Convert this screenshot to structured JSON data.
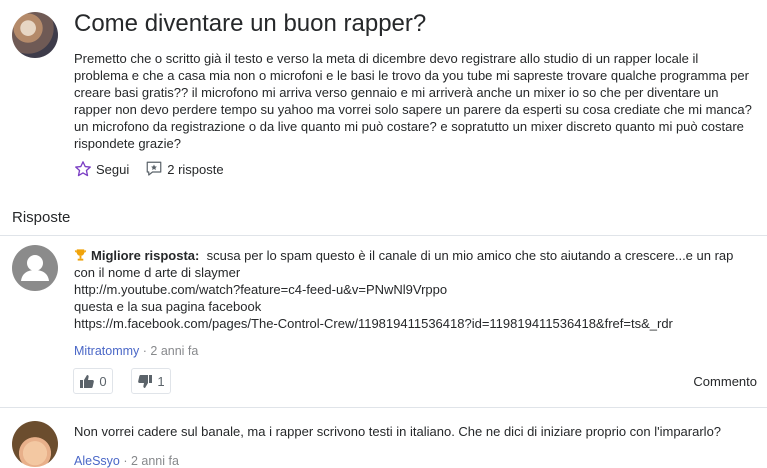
{
  "question": {
    "title": "Come diventare un buon rapper?",
    "body_lines": [
      "Premetto che o scritto già il testo e verso la meta di dicembre devo registrare allo studio di un rapper locale il",
      "problema e che a casa mia non o microfoni e le basi le trovo da you tube mi sapreste trovare qualche programma per",
      "creare basi gratis?? il microfono mi arriva verso gennaio e mi arriverà anche un mixer io so che per diventare un",
      "rapper non devo perdere tempo su yahoo ma vorrei solo sapere un parere da esperti su cosa crediate che mi manca?",
      "un microfono da registrazione o da live quanto mi può costare? e sopratutto un mixer discreto quanto mi può costare",
      "rispondete grazie?"
    ],
    "follow_label": "Segui",
    "answers_count_label": "2 risposte"
  },
  "answers_heading": "Risposte",
  "answers": [
    {
      "best_label": "Migliore risposta:",
      "lines": [
        "scusa per lo spam questo è il canale di un mio amico che sto aiutando a crescere...e un rap",
        "con il nome d arte di slaymer",
        "http://m.youtube.com/watch?feature=c4-feed-u&v=PNwNl9Vrppo",
        "questa e la sua pagina facebook",
        "https://m.facebook.com/pages/The-Control-Crew/119819411536418?id=119819411536418&fref=ts&_rdr"
      ],
      "author": "Mitratommy",
      "time": " · 2 anni fa",
      "upvotes": "0",
      "downvotes": "1",
      "comment_label": "Commento"
    },
    {
      "text": "Non vorrei cadere sul banale, ma i rapper scrivono testi in italiano. Che ne dici di iniziare proprio con l'impararlo?",
      "author": "AleSsyo",
      "time": " · 2 anni fa"
    }
  ],
  "colors": {
    "text": "#26282a",
    "muted": "#87898c",
    "author_link": "#4a67c7",
    "follow_star": "#7b3fc4",
    "trophy": "#f0a30a",
    "divider": "#e0e4e9"
  },
  "icons": {
    "follow": "star-outline-icon",
    "answers": "answer-bubble-icon",
    "best": "trophy-icon",
    "upvote": "thumbs-up-icon",
    "downvote": "thumbs-down-icon",
    "avatar_default": "default-user-icon"
  }
}
